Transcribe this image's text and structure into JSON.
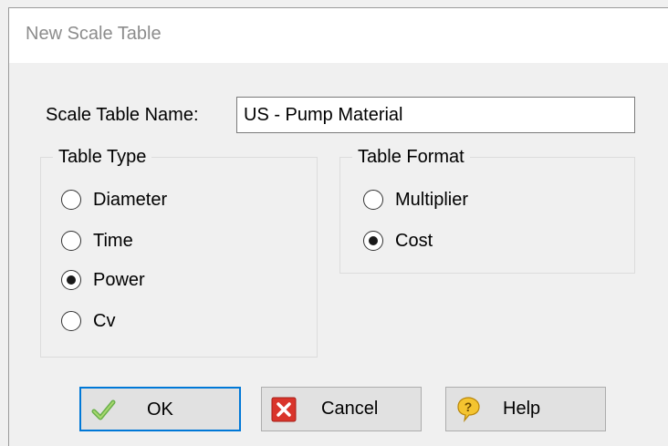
{
  "window": {
    "title": "New Scale Table"
  },
  "name_field": {
    "label": "Scale Table Name:",
    "value": "US - Pump Material"
  },
  "table_type": {
    "legend": "Table Type",
    "options": [
      {
        "label": "Diameter",
        "selected": false
      },
      {
        "label": "Time",
        "selected": false
      },
      {
        "label": "Power",
        "selected": true
      },
      {
        "label": "Cv",
        "selected": false
      }
    ]
  },
  "table_format": {
    "legend": "Table Format",
    "options": [
      {
        "label": "Multiplier",
        "selected": false
      },
      {
        "label": "Cost",
        "selected": true
      }
    ]
  },
  "buttons": {
    "ok": {
      "label": "OK",
      "icon": "checkmark-icon"
    },
    "cancel": {
      "label": "Cancel",
      "icon": "close-icon"
    },
    "help": {
      "label": "Help",
      "icon": "help-icon"
    }
  },
  "colors": {
    "default_button_border": "#0078d7",
    "title_text": "#8c8c8c"
  }
}
